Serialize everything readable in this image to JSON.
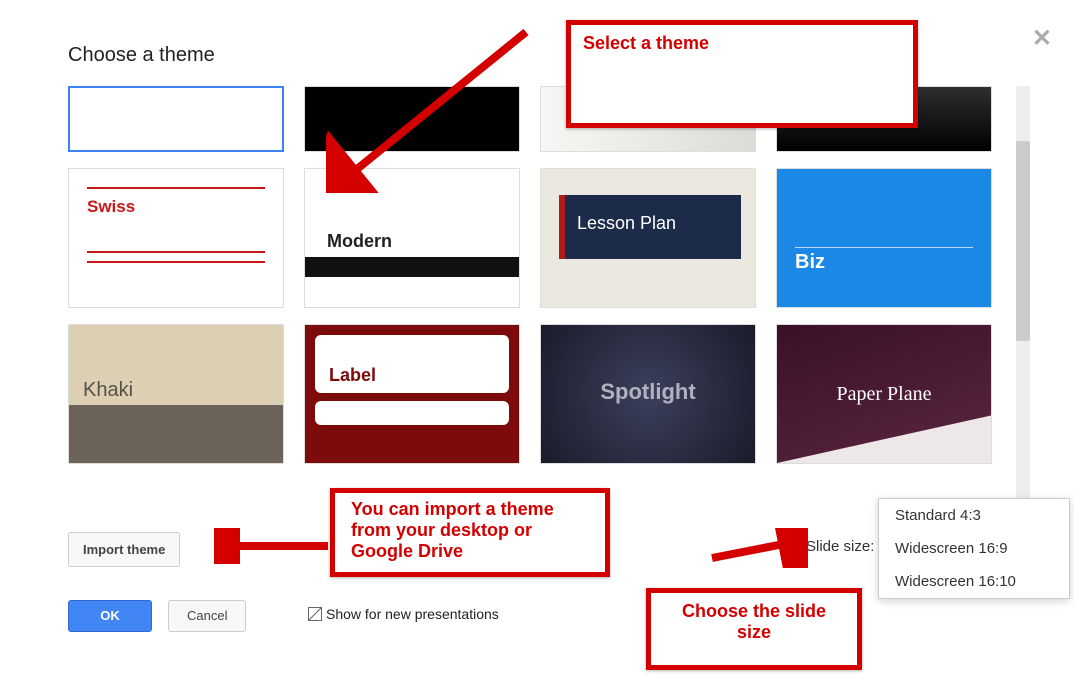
{
  "dialog_title": "Choose a theme",
  "themes": {
    "swiss": "Swiss",
    "modern": "Modern",
    "lesson": "Lesson Plan",
    "biz": "Biz",
    "khaki": "Khaki",
    "label": "Label",
    "spotlight": "Spotlight",
    "paper": "Paper Plane"
  },
  "import_btn": "Import theme",
  "slide_size_label": "Slide size:",
  "size_options": {
    "std": "Standard 4:3",
    "ws169": "Widescreen 16:9",
    "ws1610": "Widescreen 16:10"
  },
  "ok_btn": "OK",
  "cancel_btn": "Cancel",
  "show_new_label": "Show for new presentations",
  "annotations": {
    "select_theme": "Select a theme",
    "import_note": "You can import a theme from your desktop or Google Drive",
    "choose_size": "Choose the slide size"
  }
}
